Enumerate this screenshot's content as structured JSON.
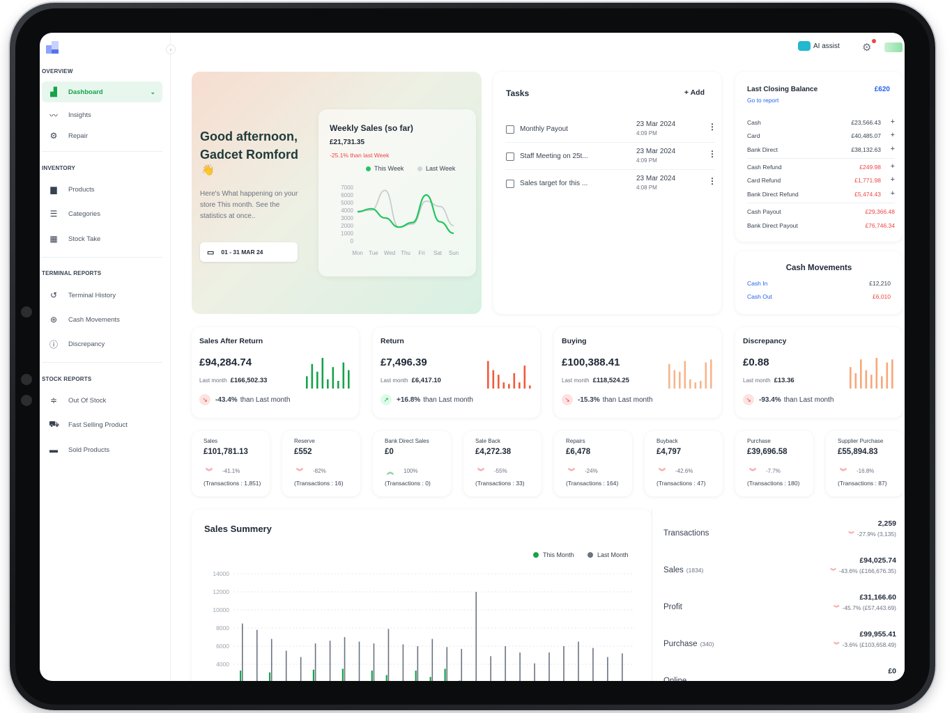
{
  "sidebar": {
    "sections": [
      "OVERVIEW",
      "INVENTORY",
      "TERMINAL REPORTS",
      "STOCK REPORTS"
    ],
    "items": [
      {
        "label": "Dashboard",
        "icon": "bar-chart-icon"
      },
      {
        "label": "Insights",
        "icon": "trend-line-icon"
      },
      {
        "label": "Repair",
        "icon": "gear-wrench-icon"
      },
      {
        "label": "Products",
        "icon": "box-icon"
      },
      {
        "label": "Categories",
        "icon": "list-icon"
      },
      {
        "label": "Stock Take",
        "icon": "building-icon"
      },
      {
        "label": "Terminal History",
        "icon": "history-icon"
      },
      {
        "label": "Cash Movements",
        "icon": "currency-icon"
      },
      {
        "label": "Discrepancy",
        "icon": "info-icon"
      },
      {
        "label": "Out Of Stock",
        "icon": "stack-icon"
      },
      {
        "label": "Fast Selling Product",
        "icon": "truck-icon"
      },
      {
        "label": "Sold Products",
        "icon": "register-icon"
      }
    ]
  },
  "topbar": {
    "ai_label": "AI assist"
  },
  "hero": {
    "greeting": "Good afternoon, Gadcet Romford",
    "emoji": "👋",
    "description": "Here's What happening on your store This month. See the statistics at once..",
    "date_range": "01 - 31 MAR 24"
  },
  "weekly": {
    "title": "Weekly Sales (so far)",
    "value": "£21,731.35",
    "delta": "-25.1% than last Week",
    "legend_this": "This Week",
    "legend_last": "Last Week",
    "y_ticks": [
      "7000",
      "6000",
      "5000",
      "4000",
      "3000",
      "2000",
      "1000",
      "0"
    ],
    "x_ticks": [
      "Mon",
      "Tue",
      "Wed",
      "Thu",
      "Fri",
      "Sat",
      "Sun"
    ]
  },
  "chart_data": [
    {
      "type": "line",
      "title": "Weekly Sales (so far)",
      "categories": [
        "Mon",
        "Tue",
        "Wed",
        "Thu",
        "Fri",
        "Sat",
        "Sun"
      ],
      "ylim": [
        0,
        7000
      ],
      "series": [
        {
          "name": "This Week",
          "color": "#22c55e",
          "values": [
            3800,
            4200,
            3000,
            1800,
            2400,
            6000,
            2500,
            1000
          ]
        },
        {
          "name": "Last Week",
          "color": "#c7ccd1",
          "values": [
            3900,
            4000,
            6600,
            1800,
            2200,
            5200,
            4500,
            2000
          ]
        }
      ]
    },
    {
      "type": "bar",
      "title": "Sales Summery",
      "ylim": [
        0,
        14000
      ],
      "y_ticks": [
        14000,
        12000,
        10000,
        8000,
        6000,
        4000
      ],
      "series": [
        {
          "name": "This Month",
          "color": "#16a34a",
          "values": [
            3300,
            1900,
            3100,
            2100,
            1000,
            3400,
            1700,
            3500,
            1400,
            3300,
            2800,
            1000,
            3300,
            2600,
            3500,
            2200,
            2000,
            1700,
            1600,
            1400,
            900,
            1900,
            900,
            1100,
            1300,
            1500,
            1200
          ]
        },
        {
          "name": "Last Month",
          "color": "#6b7280",
          "values": [
            8500,
            7800,
            6800,
            5500,
            4800,
            6300,
            6600,
            7000,
            6500,
            6300,
            7900,
            6200,
            6000,
            6800,
            5900,
            5700,
            12000,
            4900,
            6000,
            5300,
            4100,
            5300,
            6000,
            6500,
            5800,
            4800,
            5200
          ]
        }
      ]
    }
  ],
  "tasks": {
    "title": "Tasks",
    "add": "+ Add",
    "items": [
      {
        "label": "Monthly Payout",
        "date": "23 Mar 2024",
        "time": "4:09 PM"
      },
      {
        "label": "Staff Meeting on 25t...",
        "date": "23 Mar 2024",
        "time": "4:09 PM"
      },
      {
        "label": "Sales target for this ...",
        "date": "23 Mar 2024",
        "time": "4:08 PM"
      }
    ]
  },
  "closing": {
    "title": "Last Closing Balance",
    "value": "£620",
    "link": "Go to report",
    "rows": [
      {
        "label": "Cash",
        "amount": "£23,566.43"
      },
      {
        "label": "Card",
        "amount": "£40,485.07"
      },
      {
        "label": "Bank Direct",
        "amount": "£38,132.63"
      },
      {
        "label": "Cash Refund",
        "amount": "£249.98"
      },
      {
        "label": "Card Refund",
        "amount": "£1,771.98"
      },
      {
        "label": "Bank Direct Refund",
        "amount": "£5,474.43"
      },
      {
        "label": "Cash Payout",
        "amount": "£29,366.48"
      },
      {
        "label": "Bank Direct Payout",
        "amount": "£76,746.34"
      }
    ]
  },
  "cash_movements": {
    "title": "Cash Movements",
    "rows": [
      {
        "label": "Cash In",
        "amount": "£12,210"
      },
      {
        "label": "Cash Out",
        "amount": "£6,010"
      }
    ]
  },
  "stats": [
    {
      "title": "Sales After Return",
      "value": "£94,284.74",
      "last_label": "Last month",
      "last": "£166,502.33",
      "change": "-43.4%",
      "change_text": "than Last month",
      "color": "#16a34a",
      "direction": "down"
    },
    {
      "title": "Return",
      "value": "£7,496.39",
      "last_label": "Last month",
      "last": "£6,417.10",
      "change": "+16.8%",
      "change_text": "than Last month",
      "color": "#f15a3a",
      "direction": "up"
    },
    {
      "title": "Buying",
      "value": "£100,388.41",
      "last_label": "Last month",
      "last": "£118,524.25",
      "change": "-15.3%",
      "change_text": "than Last month",
      "color": "#f7b48a",
      "direction": "down"
    },
    {
      "title": "Discrepancy",
      "value": "£0.88",
      "last_label": "Last month",
      "last": "£13.36",
      "change": "-93.4%",
      "change_text": "than Last month",
      "color": "#f7a77a",
      "direction": "down"
    }
  ],
  "minis": [
    {
      "title": "Sales",
      "value": "£101,781.13",
      "pct": "-41.1%",
      "tx": "(Transactions : 1,851)",
      "up": false
    },
    {
      "title": "Reserve",
      "value": "£552",
      "pct": "-82%",
      "tx": "(Transactions : 16)",
      "up": false
    },
    {
      "title": "Bank Direct Sales",
      "value": "£0",
      "pct": "100%",
      "tx": "(Transactions : 0)",
      "up": true
    },
    {
      "title": "Sale Back",
      "value": "£4,272.38",
      "pct": "-55%",
      "tx": "(Transactions : 33)",
      "up": false
    },
    {
      "title": "Repairs",
      "value": "£6,478",
      "pct": "-24%",
      "tx": "(Transactions : 164)",
      "up": false
    },
    {
      "title": "Buyback",
      "value": "£4,797",
      "pct": "-42.6%",
      "tx": "(Transactions : 47)",
      "up": false
    },
    {
      "title": "Purchase",
      "value": "£39,696.58",
      "pct": "-7.7%",
      "tx": "(Transactions : 180)",
      "up": false
    },
    {
      "title": "Supplier Purchase",
      "value": "£55,894.83",
      "pct": "-16.8%",
      "tx": "(Transactions : 87)",
      "up": false
    }
  ],
  "summary": {
    "title": "Sales Summery",
    "legend_this": "This Month",
    "legend_last": "Last Month",
    "y_ticks": [
      "14000",
      "12000",
      "10000",
      "8000",
      "6000",
      "4000"
    ]
  },
  "summary_right": [
    {
      "label": "Transactions",
      "sub": "",
      "value": "2,259",
      "change": "-27.9% (3,135)"
    },
    {
      "label": "Sales",
      "sub": "(1834)",
      "value": "£94,025.74",
      "change": "-43.6% (£166,676.35)"
    },
    {
      "label": "Profit",
      "sub": "",
      "value": "£31,166.60",
      "change": "-45.7% (£57,443.69)"
    },
    {
      "label": "Purchase",
      "sub": "(340)",
      "value": "£99,955.41",
      "change": "-3.6% (£103,658.49)"
    },
    {
      "label": "Online",
      "sub": "",
      "value": "£0",
      "change": ""
    }
  ]
}
